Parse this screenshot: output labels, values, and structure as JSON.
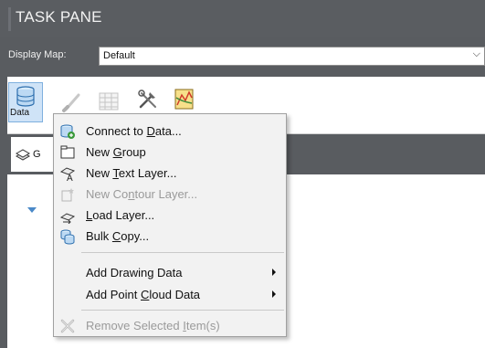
{
  "pane": {
    "title": "TASK PANE",
    "display_map_label": "Display Map:",
    "display_map_value": "Default",
    "data_button_label": "Data",
    "layer_tab_label": "G"
  },
  "colors": {
    "chrome": "#595c60",
    "title_bar": "#5a5d61",
    "accent": "#4a89c8",
    "menu_bg": "#f2f2f2",
    "disabled_text": "#9a9a9a"
  },
  "toolbar_icons": [
    "data-connect-icon",
    "style-brush-icon",
    "table-icon",
    "tools-icon",
    "map-book-icon"
  ],
  "menu": {
    "items": [
      {
        "pre": "Connect to ",
        "acc": "D",
        "post": "ata...",
        "icon": "connect-data-icon",
        "enabled": true
      },
      {
        "pre": "New ",
        "acc": "G",
        "post": "roup",
        "icon": "new-group-icon",
        "enabled": true
      },
      {
        "pre": "New ",
        "acc": "T",
        "post": "ext Layer...",
        "icon": "new-text-layer-icon",
        "enabled": true
      },
      {
        "pre": "New Co",
        "acc": "n",
        "post": "tour Layer...",
        "icon": "new-contour-layer-icon",
        "enabled": false
      },
      {
        "pre": "",
        "acc": "L",
        "post": "oad Layer...",
        "icon": "load-layer-icon",
        "enabled": true
      },
      {
        "pre": "Bulk ",
        "acc": "C",
        "post": "opy...",
        "icon": "bulk-copy-icon",
        "enabled": true
      },
      {
        "pre": "Add Drawing Data",
        "acc": "",
        "post": "",
        "icon": "",
        "enabled": true,
        "submenu": true
      },
      {
        "pre": "Add Point ",
        "acc": "C",
        "post": "loud Data",
        "icon": "",
        "enabled": true,
        "submenu": true
      },
      {
        "pre": "Remove Selected ",
        "acc": "I",
        "post": "tem(s)",
        "icon": "remove-item-icon",
        "enabled": false
      }
    ]
  }
}
